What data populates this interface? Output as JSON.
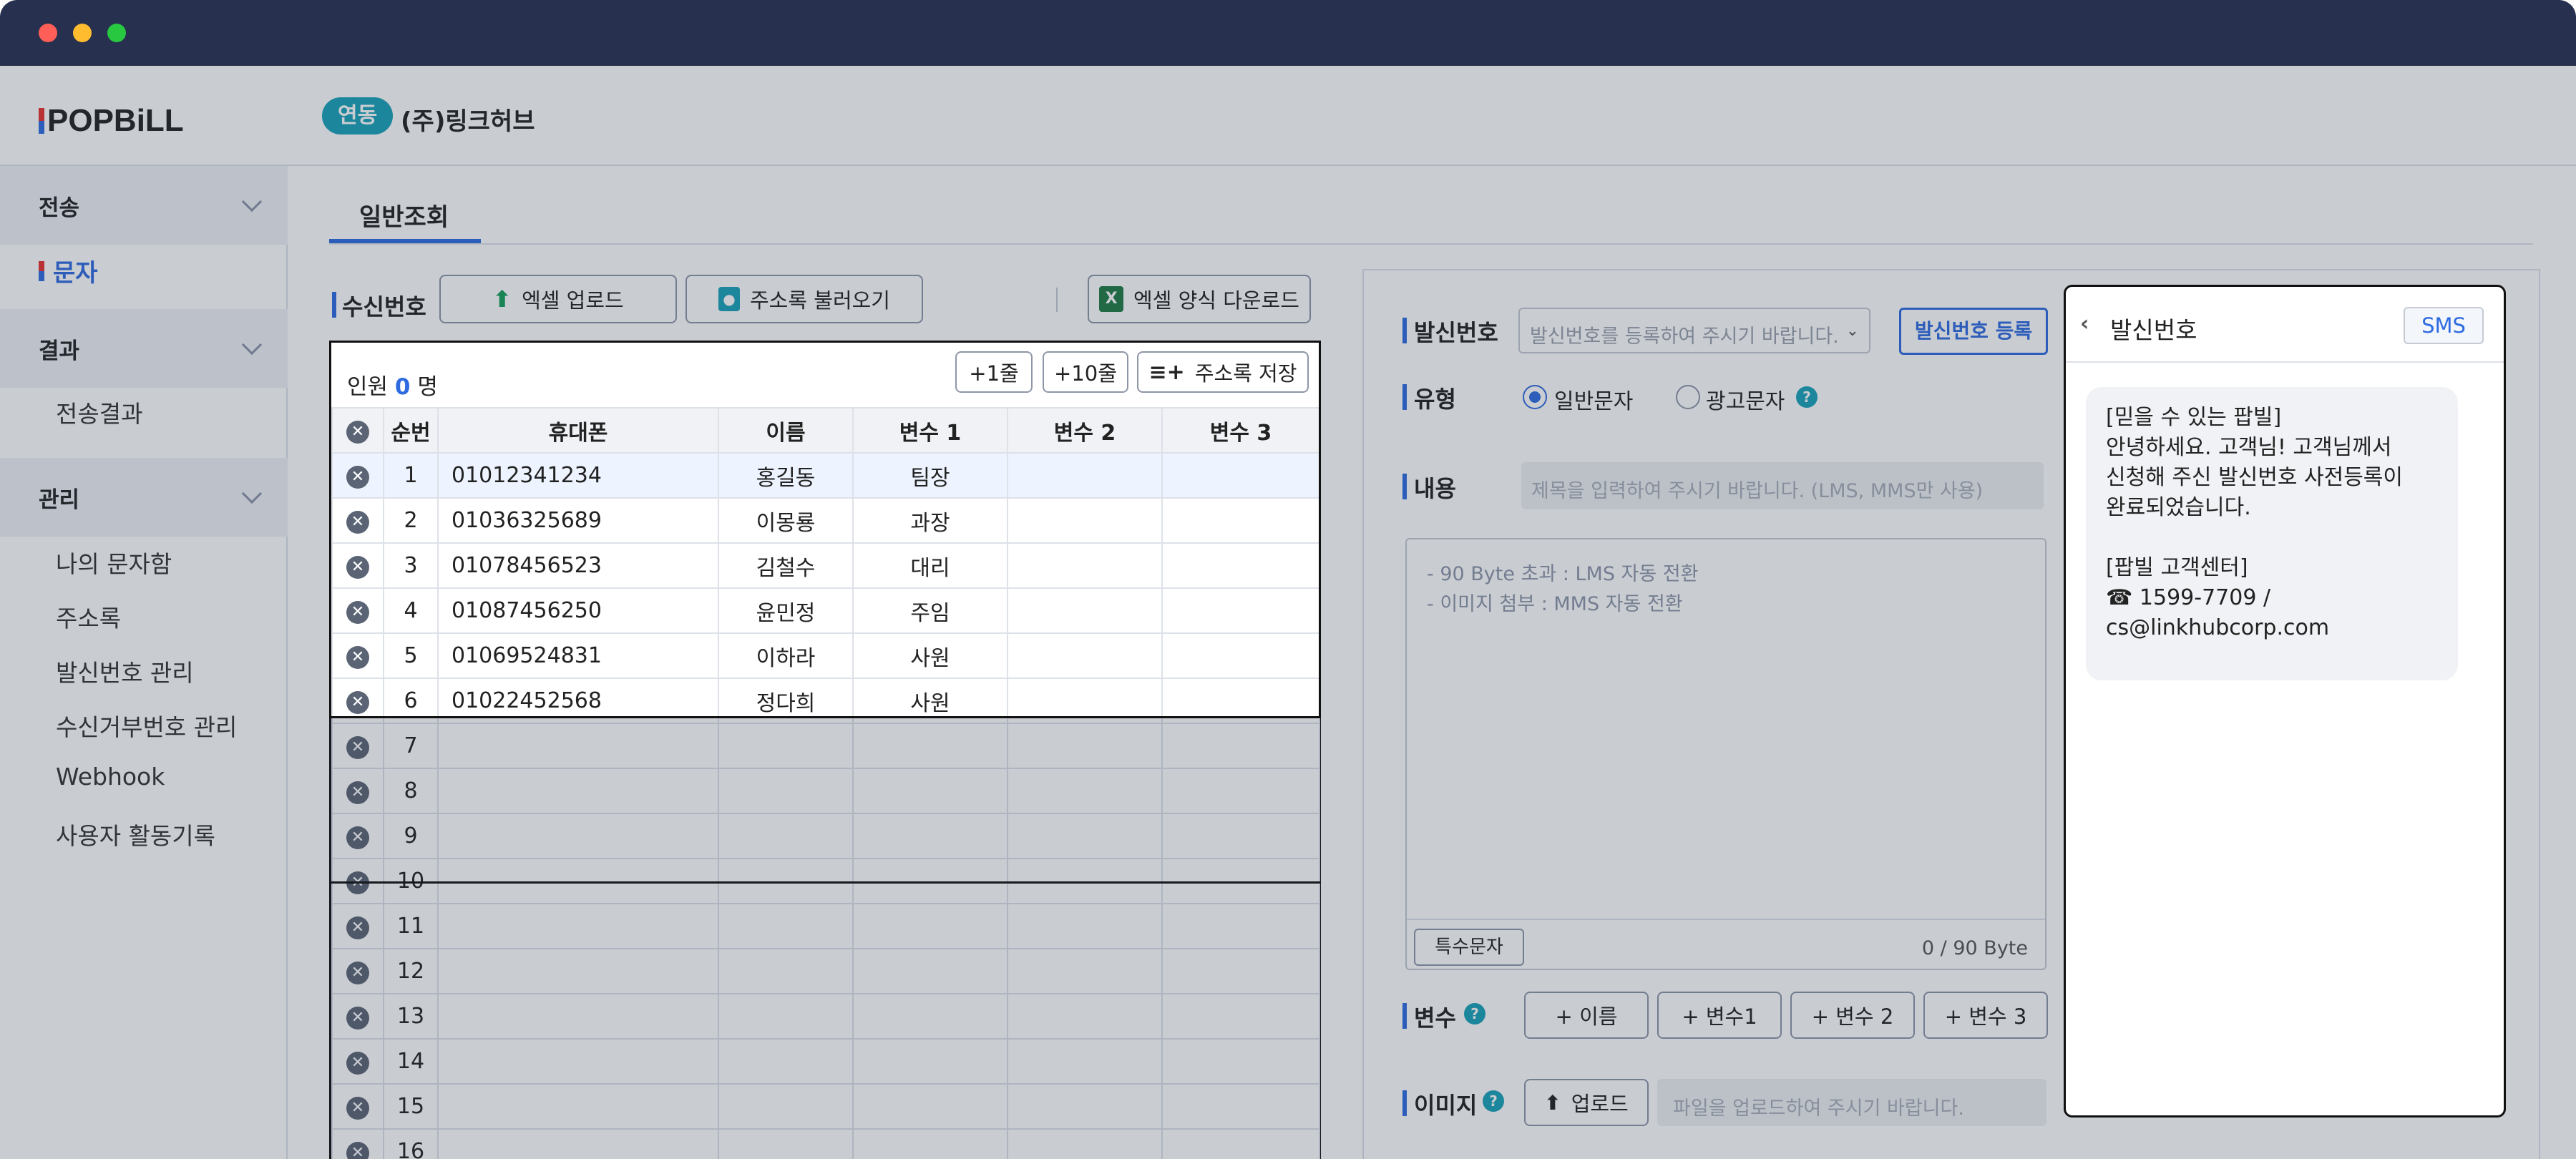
{
  "window": {
    "dot_colors": [
      "#ff5f57",
      "#febc2e",
      "#28c840"
    ]
  },
  "header": {
    "logo": "POPBiLL",
    "badge": "연동",
    "company": "(주)링크허브"
  },
  "sidebar": {
    "groups": [
      {
        "label": "전송"
      },
      {
        "label": "결과"
      },
      {
        "label": "관리"
      }
    ],
    "active_item": "문자",
    "result_items": [
      "전송결과"
    ],
    "manage_items": [
      "나의 문자함",
      "주소록",
      "발신번호 관리",
      "수신거부번호 관리",
      "Webhook",
      "사용자 활동기록"
    ]
  },
  "main": {
    "tab": "일반조회",
    "recipients": {
      "label": "수신번호",
      "excel_upload": "엑셀 업로드",
      "load_address": "주소록 불러오기",
      "excel_template": "엑셀 양식 다운로드",
      "count_prefix": "인원",
      "count": "0",
      "count_suffix": "명",
      "add_one": "+1줄",
      "add_ten": "+10줄",
      "save_address": "주소록 저장",
      "columns": [
        "순번",
        "휴대폰",
        "이름",
        "변수 1",
        "변수 2",
        "변수 3"
      ],
      "rows": [
        {
          "no": "1",
          "phone": "01012341234",
          "name": "홍길동",
          "v1": "팀장",
          "v2": "",
          "v3": ""
        },
        {
          "no": "2",
          "phone": "01036325689",
          "name": "이몽룡",
          "v1": "과장",
          "v2": "",
          "v3": ""
        },
        {
          "no": "3",
          "phone": "01078456523",
          "name": "김철수",
          "v1": "대리",
          "v2": "",
          "v3": ""
        },
        {
          "no": "4",
          "phone": "01087456250",
          "name": "윤민정",
          "v1": "주임",
          "v2": "",
          "v3": ""
        },
        {
          "no": "5",
          "phone": "01069524831",
          "name": "이하라",
          "v1": "사원",
          "v2": "",
          "v3": ""
        },
        {
          "no": "6",
          "phone": "01022452568",
          "name": "정다희",
          "v1": "사원",
          "v2": "",
          "v3": ""
        }
      ],
      "empty_rows": [
        "7",
        "8",
        "9",
        "10",
        "11",
        "12",
        "13",
        "14",
        "15",
        "16"
      ]
    },
    "form": {
      "sender_label": "발신번호",
      "sender_placeholder": "발신번호를 등록하여 주시기 바랍니다.",
      "sender_register": "발신번호 등록",
      "type_label": "유형",
      "type_general": "일반문자",
      "type_ad": "광고문자",
      "help_glyph": "?",
      "content_label": "내용",
      "subject_placeholder": "제목을 입력하여 주시기 바랍니다. (LMS, MMS만 사용)",
      "hint_1": "- 90 Byte 초과 : LMS 자동 전환",
      "hint_2": "- 이미지 첨부 : MMS 자동 전환",
      "special_chars": "특수문자",
      "byte_count": "0 / 90 Byte",
      "vars_label": "변수",
      "var_buttons": [
        "+ 이름",
        "+ 변수1",
        "+ 변수 2",
        "+ 변수 3"
      ],
      "image_label": "이미지",
      "upload": "업로드",
      "upload_placeholder": "파일을 업로드하여 주시기 바랍니다."
    },
    "preview": {
      "title": "발신번호",
      "badge": "SMS",
      "lines": [
        "[믿을 수 있는 팝빌]",
        "안녕하세요. 고객님! 고객님께서",
        "신청해 주신 발신번호 사전등록이",
        "완료되었습니다.",
        "",
        "[팝빌 고객센터]",
        "☎ 1599-7709 /",
        "cs@linkhubcorp.com"
      ]
    }
  }
}
